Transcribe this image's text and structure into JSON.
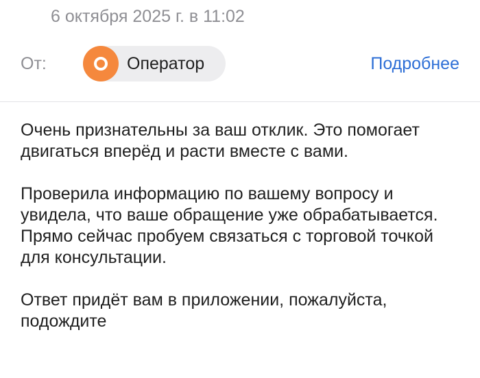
{
  "header": {
    "date": "6 октября 2025 г. в 11:02",
    "from_label": "От:",
    "sender_name": "Оператор",
    "avatar_icon": "operator-logo-icon",
    "avatar_color": "#f5883d",
    "details_link": "Подробнее",
    "link_color": "#2e6fd6"
  },
  "message": {
    "paragraphs": [
      "Очень признательны за ваш отклик. Это помогает двигаться вперёд и расти вместе с вами.",
      "Проверила информацию по вашему вопросу и увидела, что ваше обращение уже обрабатывается.",
      "Прямо сейчас пробуем связаться с торговой точкой для консультации.",
      "Ответ придёт вам в приложении, пожалуйста, подождите"
    ]
  }
}
